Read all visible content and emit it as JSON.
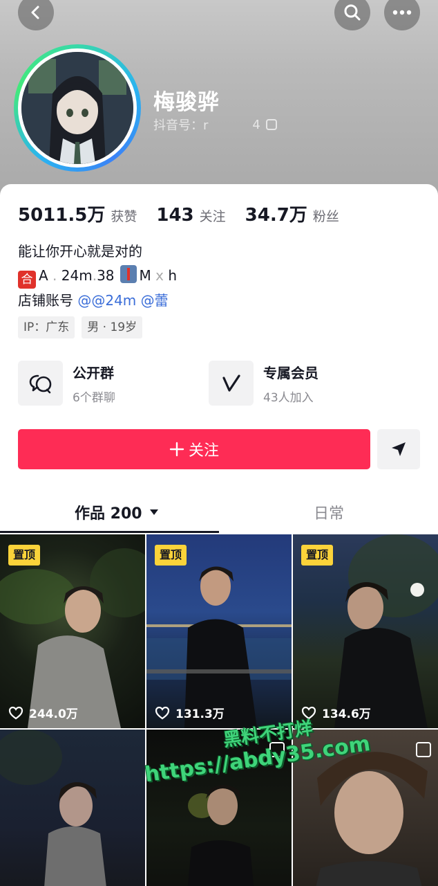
{
  "profile": {
    "name": "梅骏骅",
    "account_label": "抖音号：r",
    "account_tail": "4"
  },
  "stats": [
    {
      "value": "5011.5万",
      "label": "获赞"
    },
    {
      "value": "143",
      "label": "关注"
    },
    {
      "value": "34.7万",
      "label": "粉丝"
    }
  ],
  "bio": {
    "line1": "能让你开心就是对的",
    "line2_he": "合",
    "line2_a": "A",
    "line2_b": "24m",
    "line2_c": "38",
    "line2_d": "M",
    "line2_e": "h",
    "line3_prefix": "店铺账号",
    "line3_mention1": "@@24m",
    "line3_mention2": "@蕾"
  },
  "tags": [
    "IP：广东",
    "男 · 19岁"
  ],
  "groups": [
    {
      "title": "公开群",
      "sub": "6个群聊",
      "icon": "chat-bubbles-icon"
    },
    {
      "title": "专属会员",
      "sub": "43人加入",
      "icon": "vip-v-icon"
    }
  ],
  "actions": {
    "follow": "关注",
    "follow_icon": "plus-icon",
    "share_icon": "send-icon"
  },
  "tabs": [
    {
      "label": "作品 200",
      "active": true
    },
    {
      "label": "日常",
      "active": false
    }
  ],
  "videos": [
    {
      "pinned": "置顶",
      "likes": "244.0万"
    },
    {
      "pinned": "置顶",
      "likes": "131.3万"
    },
    {
      "pinned": "置顶",
      "likes": "134.6万"
    },
    {
      "pinned": "",
      "likes": ""
    },
    {
      "pinned": "",
      "likes": ""
    },
    {
      "pinned": "",
      "likes": ""
    }
  ],
  "watermark": {
    "line1": "黑料不打烊",
    "line2": "https://abdy35.com"
  },
  "colors": {
    "accent": "#fe2c55",
    "pin": "#fbd33a",
    "mention": "#3a6dd8"
  }
}
